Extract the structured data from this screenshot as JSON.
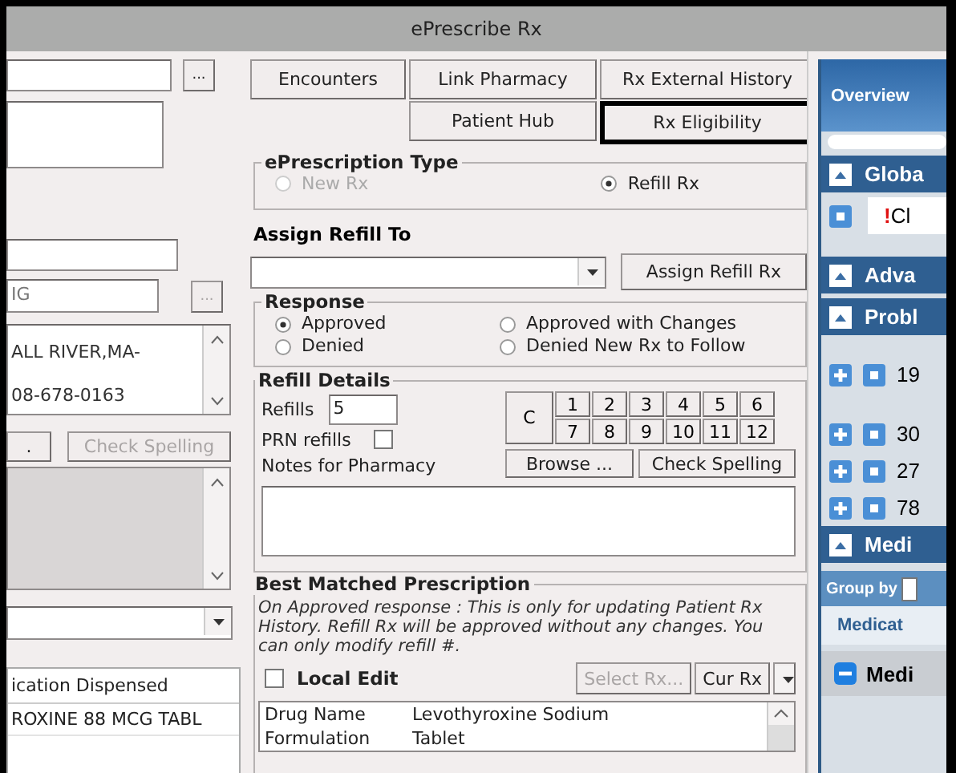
{
  "window": {
    "title": "ePrescribe Rx"
  },
  "left": {
    "browse_buttons": [
      {
        "label": "...",
        "disabled": false
      },
      {
        "label": "...",
        "disabled": true
      }
    ],
    "pharmacy_field": {
      "value": "IG"
    },
    "address_lines": [
      "ALL RIVER,MA-",
      "08-678-0163"
    ],
    "buttons": [
      {
        "label": ".",
        "disabled": false
      },
      {
        "label": "Check Spelling",
        "disabled": true
      }
    ],
    "table": {
      "columns": [
        "ication Dispensed"
      ],
      "rows": [
        [
          "ROXINE 88 MCG TABL"
        ]
      ]
    }
  },
  "middle": {
    "toolbar": [
      {
        "label": "Encounters",
        "highlighted": false
      },
      {
        "label": "Link Pharmacy",
        "highlighted": false
      },
      {
        "label": "Rx External History",
        "highlighted": false
      },
      {
        "label": "Patient Hub",
        "highlighted": false
      },
      {
        "label": "Rx Eligibility",
        "highlighted": true
      }
    ],
    "eprescription_type": {
      "title": "ePrescription Type",
      "options": [
        {
          "label": "New Rx",
          "selected": false,
          "disabled": true
        },
        {
          "label": "Refill Rx",
          "selected": true,
          "disabled": false
        }
      ]
    },
    "assign_refill": {
      "label": "Assign Refill To",
      "button": "Assign Refill Rx"
    },
    "response": {
      "title": "Response",
      "options": [
        {
          "label": "Approved",
          "selected": true
        },
        {
          "label": "Approved with Changes",
          "selected": false
        },
        {
          "label": "Denied",
          "selected": false
        },
        {
          "label": "Denied New Rx to Follow",
          "selected": false
        }
      ]
    },
    "refill_details": {
      "title": "Refill Details",
      "refills_label": "Refills",
      "refills_value": "5",
      "prn_label": "PRN refills",
      "prn_checked": false,
      "notes_label": "Notes for Pharmacy",
      "clear_key": "C",
      "keys": [
        "1",
        "2",
        "3",
        "4",
        "5",
        "6",
        "7",
        "8",
        "9",
        "10",
        "11",
        "12"
      ],
      "buttons": [
        "Browse ...",
        "Check Spelling"
      ]
    },
    "best_matched": {
      "title": "Best Matched Prescription",
      "note": "On Approved response : This is only for updating Patient Rx History. Refill Rx will be approved without any changes. You can only modify refill #.",
      "local_edit": {
        "label": "Local Edit",
        "checked": false
      },
      "buttons": [
        {
          "label": "Select Rx...",
          "disabled": true
        },
        {
          "label": "Cur Rx",
          "disabled": false
        }
      ],
      "rows": [
        [
          "Drug Name",
          "Levothyroxine Sodium"
        ],
        [
          "Formulation",
          "Tablet"
        ]
      ]
    }
  },
  "right": {
    "tab": "Overview",
    "items": [
      {
        "kind": "header",
        "label": "Globa"
      },
      {
        "kind": "alert",
        "mark": "!",
        "label": "Cl"
      },
      {
        "kind": "header",
        "label": "Adva"
      },
      {
        "kind": "header",
        "label": "Probl"
      },
      {
        "kind": "problem",
        "label": "19"
      },
      {
        "kind": "problem",
        "label": "30"
      },
      {
        "kind": "problem",
        "label": "27"
      },
      {
        "kind": "problem",
        "label": "78"
      },
      {
        "kind": "header",
        "label": "Medi"
      },
      {
        "kind": "groupby",
        "label": "Group by"
      },
      {
        "kind": "column",
        "label": "Medicat"
      },
      {
        "kind": "group",
        "label": "Medi"
      }
    ]
  }
}
